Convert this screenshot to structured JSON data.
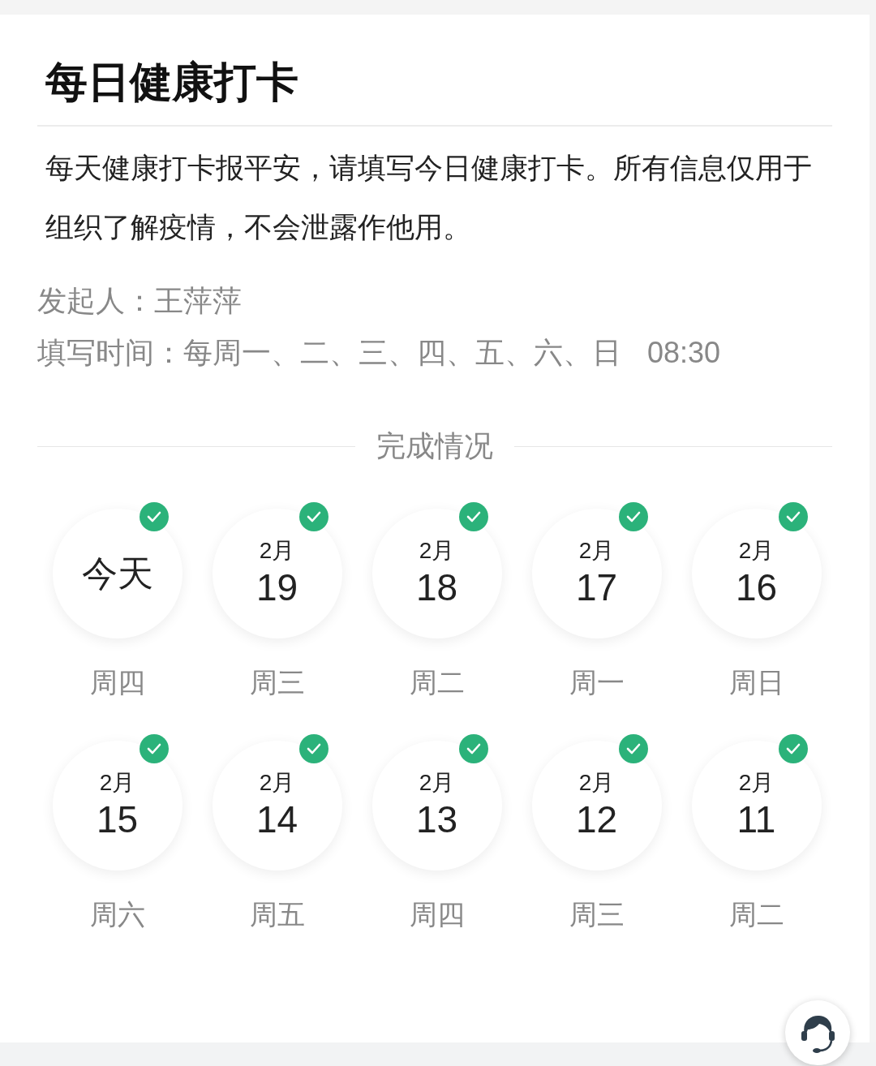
{
  "title": "每日健康打卡",
  "description": "每天健康打卡报平安，请填写今日健康打卡。所有信息仅用于组织了解疫情，不会泄露作他用。",
  "meta": [
    {
      "label": "发起人：",
      "value": "王萍萍"
    },
    {
      "label": "填写时间：",
      "value": "每周一、二、三、四、五、六、日",
      "time": "08:30"
    }
  ],
  "section_title": "完成情况",
  "days": [
    {
      "kind": "today",
      "label": "今天",
      "weekday": "周四",
      "checked": true
    },
    {
      "kind": "date",
      "month": "2月",
      "day": "19",
      "weekday": "周三",
      "checked": true
    },
    {
      "kind": "date",
      "month": "2月",
      "day": "18",
      "weekday": "周二",
      "checked": true
    },
    {
      "kind": "date",
      "month": "2月",
      "day": "17",
      "weekday": "周一",
      "checked": true
    },
    {
      "kind": "date",
      "month": "2月",
      "day": "16",
      "weekday": "周日",
      "checked": true
    },
    {
      "kind": "date",
      "month": "2月",
      "day": "15",
      "weekday": "周六",
      "checked": true
    },
    {
      "kind": "date",
      "month": "2月",
      "day": "14",
      "weekday": "周五",
      "checked": true
    },
    {
      "kind": "date",
      "month": "2月",
      "day": "13",
      "weekday": "周四",
      "checked": true
    },
    {
      "kind": "date",
      "month": "2月",
      "day": "12",
      "weekday": "周三",
      "checked": true
    },
    {
      "kind": "date",
      "month": "2月",
      "day": "11",
      "weekday": "周二",
      "checked": true
    }
  ]
}
